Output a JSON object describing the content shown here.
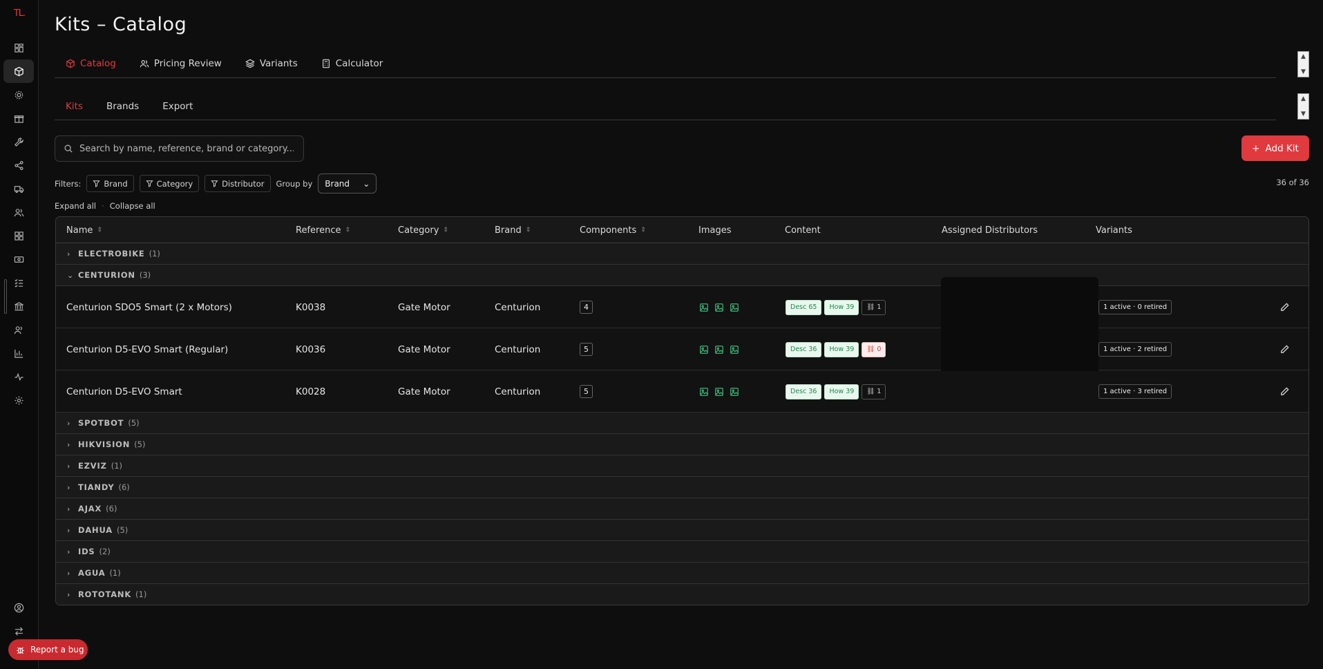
{
  "app": {
    "logo": "TL."
  },
  "page": {
    "title": "Kits – Catalog"
  },
  "main_tabs": [
    {
      "label": "Catalog",
      "icon": "box-icon",
      "active": true
    },
    {
      "label": "Pricing Review",
      "icon": "users-icon",
      "active": false
    },
    {
      "label": "Variants",
      "icon": "layers-icon",
      "active": false
    },
    {
      "label": "Calculator",
      "icon": "calculator-icon",
      "active": false
    }
  ],
  "sub_tabs": [
    {
      "label": "Kits",
      "active": true
    },
    {
      "label": "Brands",
      "active": false
    },
    {
      "label": "Export",
      "active": false
    }
  ],
  "search": {
    "placeholder": "Search by name, reference, brand or category..."
  },
  "add_button": {
    "label": "Add Kit"
  },
  "filters": {
    "label": "Filters:",
    "chips": [
      "Brand",
      "Category",
      "Distributor"
    ],
    "group_by_label": "Group by",
    "group_by_value": "Brand"
  },
  "result_count": "36 of 36",
  "expand_all": "Expand all",
  "collapse_all": "Collapse all",
  "columns": [
    "Name",
    "Reference",
    "Category",
    "Brand",
    "Components",
    "Images",
    "Content",
    "Assigned Distributors",
    "Variants"
  ],
  "groups_before": [
    {
      "name": "ELECTROBIKE",
      "count": "(1)"
    }
  ],
  "expanded_group": {
    "name": "CENTURION",
    "count": "(3)"
  },
  "rows": [
    {
      "name": "Centurion SDO5 Smart (2 x Motors)",
      "reference": "K0038",
      "category": "Gate Motor",
      "brand": "Centurion",
      "components": "4",
      "desc": "Desc 65",
      "how": "How 39",
      "links": "1",
      "variants": "1 active · 0 retired"
    },
    {
      "name": "Centurion D5-EVO Smart (Regular)",
      "reference": "K0036",
      "category": "Gate Motor",
      "brand": "Centurion",
      "components": "5",
      "desc": "Desc 36",
      "how": "How 39",
      "links": "0",
      "variants": "1 active · 2 retired"
    },
    {
      "name": "Centurion D5-EVO Smart",
      "reference": "K0028",
      "category": "Gate Motor",
      "brand": "Centurion",
      "components": "5",
      "desc": "Desc 36",
      "how": "How 39",
      "links": "1",
      "variants": "1 active · 3 retired"
    }
  ],
  "groups_after": [
    {
      "name": "SPOTBOT",
      "count": "(5)"
    },
    {
      "name": "HIKVISION",
      "count": "(5)"
    },
    {
      "name": "EZVIZ",
      "count": "(1)"
    },
    {
      "name": "TIANDY",
      "count": "(6)"
    },
    {
      "name": "AJAX",
      "count": "(6)"
    },
    {
      "name": "DAHUA",
      "count": "(5)"
    },
    {
      "name": "IDS",
      "count": "(2)"
    },
    {
      "name": "AGUA",
      "count": "(1)"
    },
    {
      "name": "ROTOTANK",
      "count": "(1)"
    }
  ],
  "report_bug": "Report a bug",
  "colors": {
    "accent": "#e5383b",
    "background": "#0e0e0e",
    "success": "#3cb878"
  }
}
